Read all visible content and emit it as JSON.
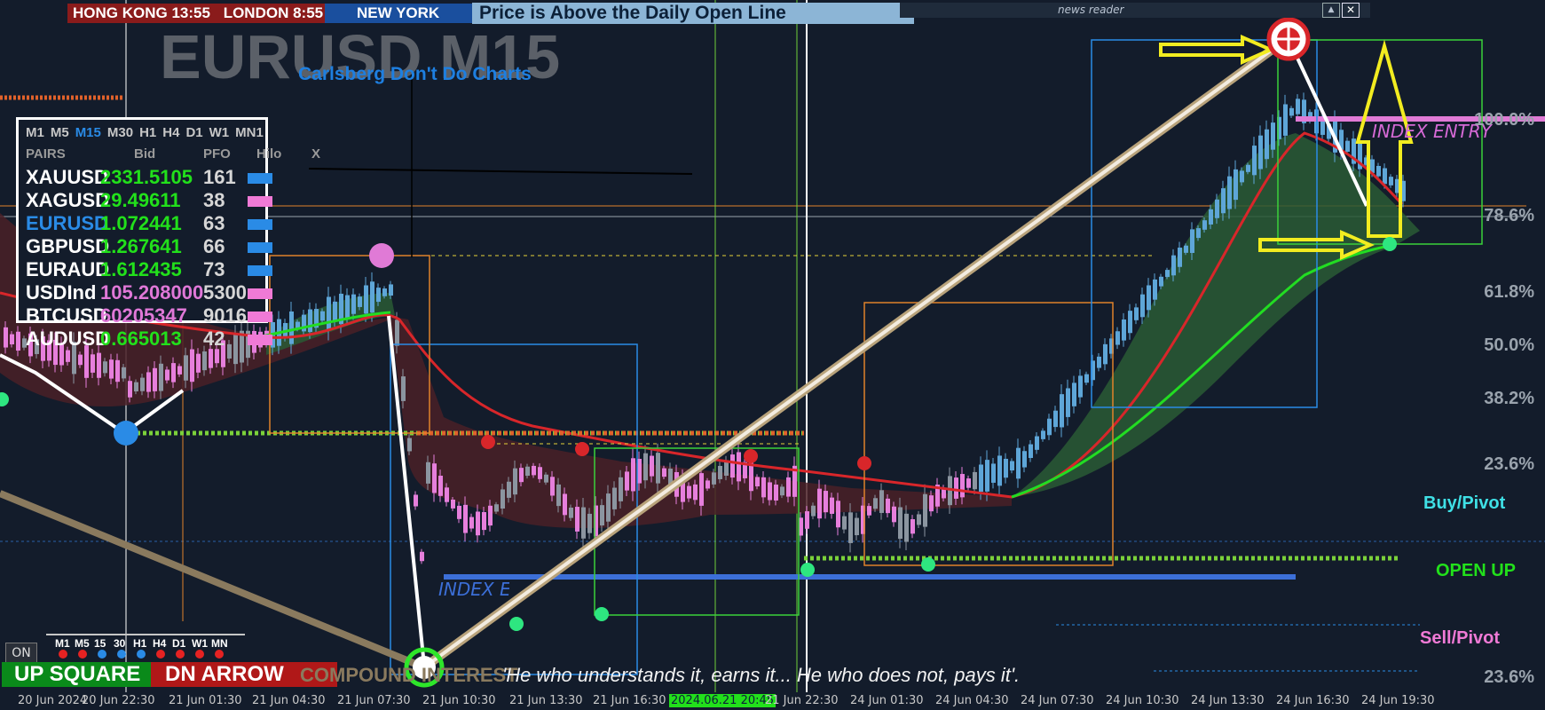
{
  "window": {
    "symbol_title": "EURUSD M15",
    "subtitle": "Carlsberg Don't Do Charts"
  },
  "sessions": {
    "hong_kong": "HONG KONG",
    "hk_time": "13:55",
    "london": "LONDON",
    "london_time": "8:55",
    "new_york": "NEW YORK"
  },
  "headline": "Price is Above the Daily Open Line",
  "news_reader": {
    "label": "news reader",
    "minimize": "▲",
    "close": "✕"
  },
  "pair_panel": {
    "timeframes": [
      "M1",
      "M5",
      "M15",
      "M30",
      "H1",
      "H4",
      "D1",
      "W1",
      "MN1"
    ],
    "active_timeframe": "M15",
    "headers": {
      "pairs": "PAIRS",
      "bid": "Bid",
      "pfo": "PFO",
      "hilo": "Hilo",
      "x": "X"
    },
    "rows": [
      {
        "sym": "XAUUSD",
        "bid": "2331.5105",
        "pfo": "161",
        "bid_color": "#22e01b",
        "hilo_color": "#2a8be6"
      },
      {
        "sym": "XAGUSD",
        "bid": "29.49611",
        "pfo": "38",
        "bid_color": "#22e01b",
        "hilo_color": "#f07ad6"
      },
      {
        "sym": "EURUSD",
        "bid": "1.072441",
        "pfo": "63",
        "bid_color": "#22e01b",
        "hilo_color": "#2a8be6",
        "sym_color": "#2a8be6"
      },
      {
        "sym": "GBPUSD",
        "bid": "1.267641",
        "pfo": "66",
        "bid_color": "#22e01b",
        "hilo_color": "#2a8be6"
      },
      {
        "sym": "EURAUD",
        "bid": "1.612435",
        "pfo": "73",
        "bid_color": "#22e01b",
        "hilo_color": "#2a8be6"
      },
      {
        "sym": "USDInd",
        "bid": "105.208000",
        "pfo": "5300",
        "bid_color": "#e078d8",
        "hilo_color": "#f07ad6"
      },
      {
        "sym": "BTCUSD",
        "bid": "60205347",
        "pfo": "9016",
        "bid_color": "#e078d8",
        "hilo_color": "#f07ad6"
      },
      {
        "sym": "AUDUSD",
        "bid": "0.665013",
        "pfo": "42",
        "bid_color": "#22e01b",
        "hilo_color": "#f07ad6"
      }
    ]
  },
  "mini_tf": {
    "labels": [
      "M1",
      "M5",
      "15",
      "30",
      "H1",
      "H4",
      "D1",
      "W1",
      "MN"
    ],
    "dot_colors": [
      "#e52222",
      "#e52222",
      "#2a8be6",
      "#2a8be6",
      "#2a8be6",
      "#e52222",
      "#e52222",
      "#e52222",
      "#e52222"
    ]
  },
  "buttons": {
    "on": "ON",
    "up_square": "UP SQUARE",
    "dn_arrow": "DN ARROW",
    "compound": "COMPOUND INTEREST"
  },
  "quote": "'He who understands it, earns it... He who does not, pays it'.",
  "chart_labels": {
    "index_entry": "INDEX ENTRY",
    "index_entry_low": "INDEX ENTRY"
  },
  "fib_levels": [
    "100.0%",
    "78.6%",
    "61.8%",
    "50.0%",
    "38.2%",
    "23.6%",
    "23.6%"
  ],
  "pivot_labels": {
    "buy": "Buy/Pivot",
    "open_up": "OPEN UP",
    "sell": "Sell/Pivot"
  },
  "time_axis": [
    "20 Jun 2024",
    "20 Jun 22:30",
    "21 Jun 01:30",
    "21 Jun 04:30",
    "21 Jun 07:30",
    "21 Jun 10:30",
    "21 Jun 13:30",
    "21 Jun 16:30",
    "2024.06.21 20:45",
    "21 Jun 22:30",
    "24 Jun 01:30",
    "24 Jun 04:30",
    "24 Jun 07:30",
    "24 Jun 10:30",
    "24 Jun 13:30",
    "24 Jun 16:30",
    "24 Jun 19:30"
  ],
  "colors": {
    "background": "#131c2b",
    "bull_candle": "#5ea6d8",
    "bear_candle": "#e67fdc",
    "ema_red": "#d8262a",
    "ema_green": "#22dd22",
    "trend_tan": "#b8a27a"
  }
}
